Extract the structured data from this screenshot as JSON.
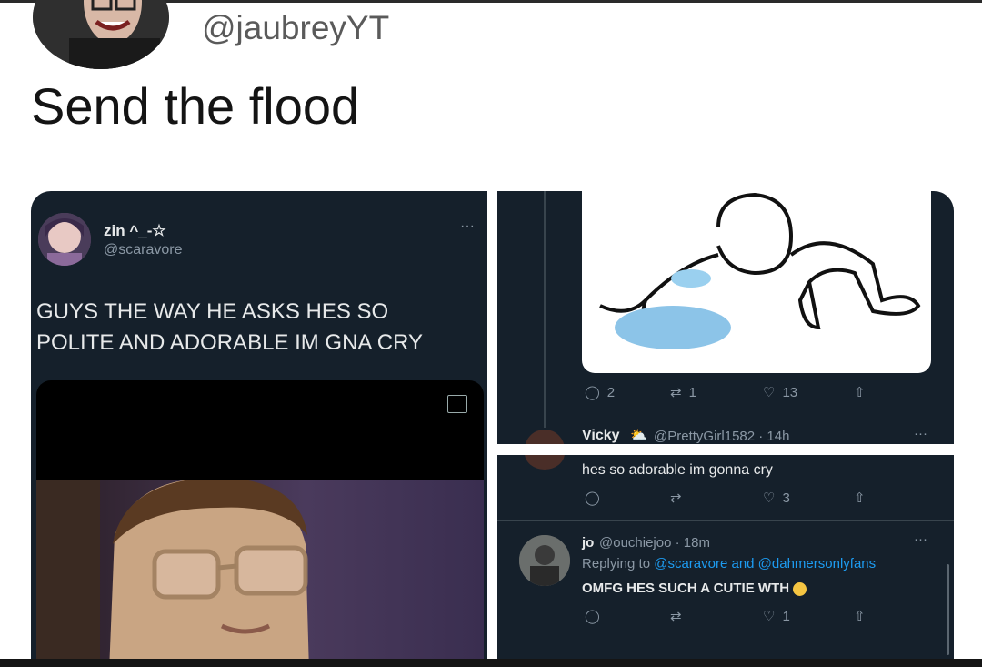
{
  "tweet": {
    "handle": "@jaubreyYT",
    "text": "Send the flood"
  },
  "left_shot": {
    "display_name": "zin ^_-☆",
    "handle": "@scaravore",
    "more": "···",
    "text_line1": "GUYS THE WAY HE ASKS HES SO",
    "text_line2": "POLITE AND ADORABLE IM GNA CRY",
    "video_icon": "captions-icon"
  },
  "right_top": {
    "replies": "2",
    "retweets": "1",
    "likes": "13",
    "reply_name": "Vicky",
    "reply_handle_time": "@PrettyGirl1582 · 14h",
    "more": "···"
  },
  "right_bottom": {
    "reply1_text": "hes so adorable im gonna cry",
    "reply1_likes": "3",
    "reply2_name": "jo",
    "reply2_handle_time": "@ouchiejoo · 18m",
    "reply2_replying_prefix": "Replying to",
    "reply2_replying_to": "@scaravore and @dahmersonlyfans",
    "reply2_text": "OMFG HES SUCH A CUTIE WTH",
    "reply2_likes": "1",
    "more": "···"
  },
  "colors": {
    "dark_bg": "#15202b",
    "accent": "#1d9bf0",
    "muted": "#8b98a5"
  }
}
